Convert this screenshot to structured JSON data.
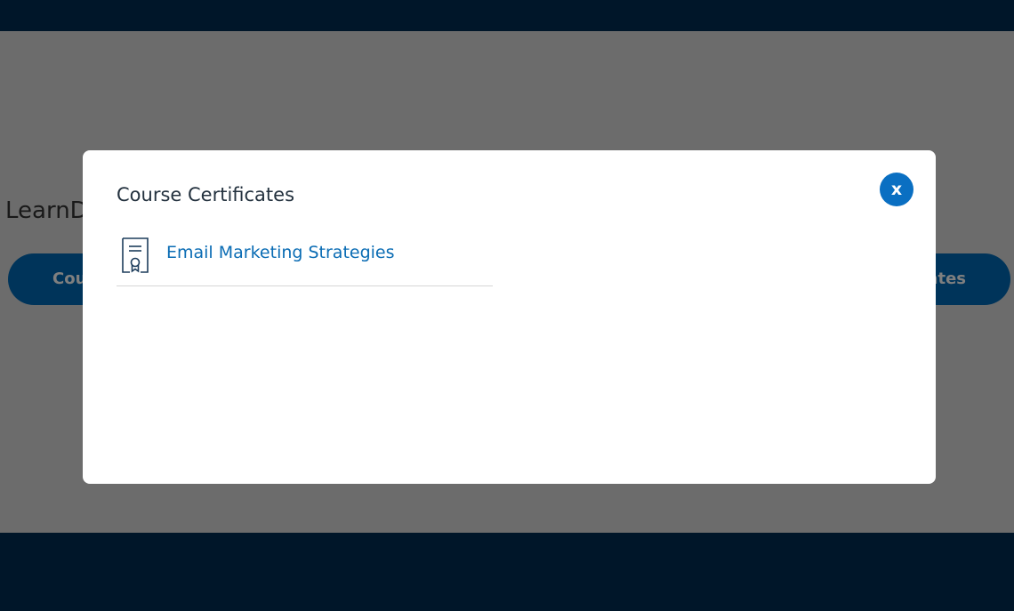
{
  "background": {
    "heading": "LearnD",
    "left_pill_label": "Cou",
    "right_pill_label": "ates"
  },
  "modal": {
    "title": "Course Certificates",
    "close_label": "x",
    "certificates": [
      {
        "title": "Email Marketing Strategies",
        "icon": "certificate-icon"
      }
    ]
  },
  "colors": {
    "header": "#002d52",
    "accent": "#0a6fc2",
    "link": "#0a6cb4",
    "overlay": "rgba(0,0,0,0.5)"
  }
}
